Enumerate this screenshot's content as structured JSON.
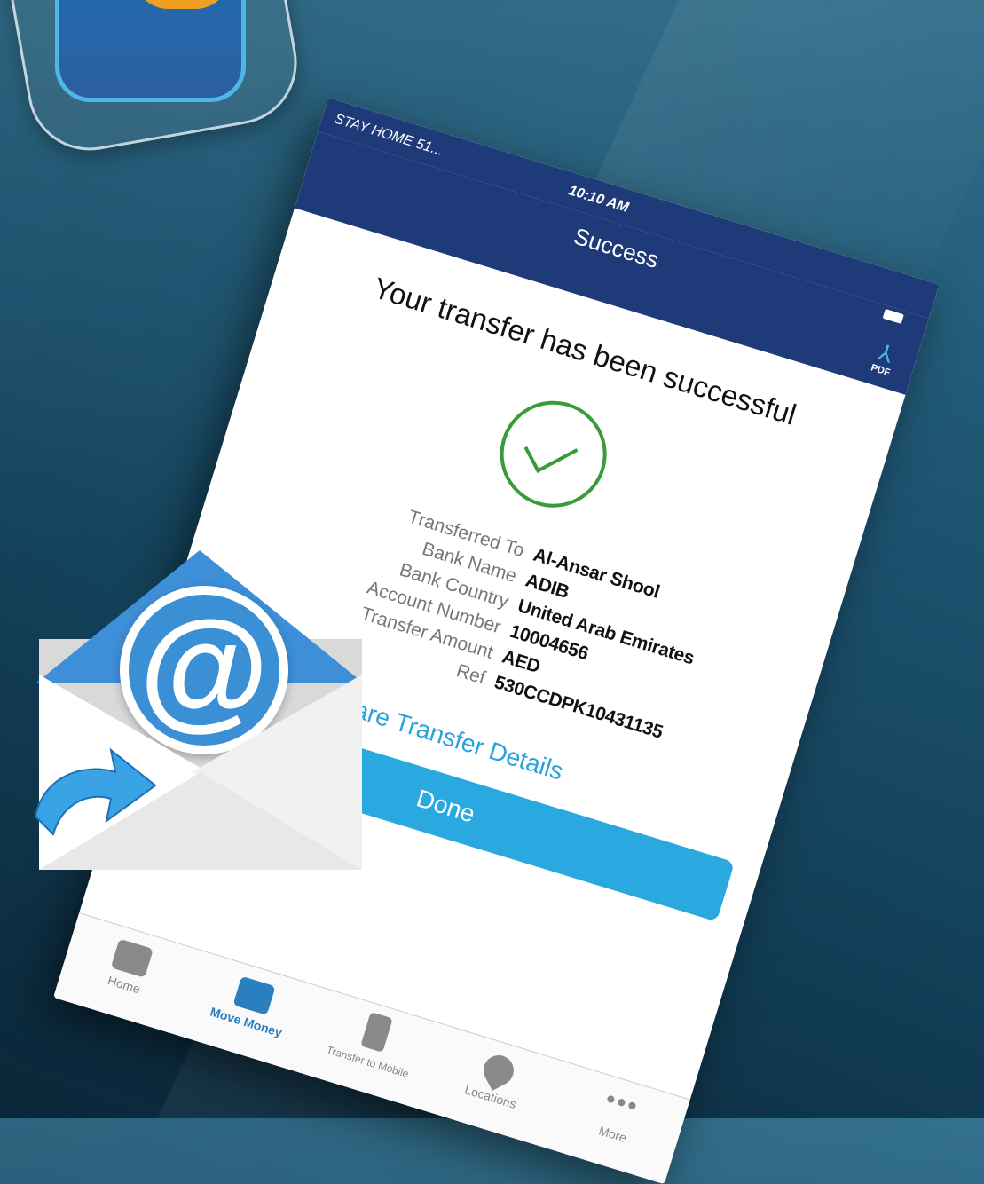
{
  "status": {
    "carrier": "STAY HOME 51...",
    "time": "10:10 AM"
  },
  "header": {
    "title": "Success",
    "pdf_label": "PDF"
  },
  "headline": "Your transfer has been successful",
  "details": [
    {
      "label": "Transferred To",
      "value": "Al-Ansar Shool"
    },
    {
      "label": "Bank Name",
      "value": "ADIB"
    },
    {
      "label": "Bank Country",
      "value": "United Arab Emirates"
    },
    {
      "label": "Account Number",
      "value": "10004656"
    },
    {
      "label": "Transfer Amount",
      "value": "AED"
    },
    {
      "label": "Ref",
      "value": "530CCDPK10431135"
    }
  ],
  "share_label": "Share Transfer Details",
  "done_label": "Done",
  "tabs": [
    {
      "label": "Home",
      "icon": "wallet-icon"
    },
    {
      "label": "Move Money",
      "icon": "money-transfer-icon",
      "active": true
    },
    {
      "label": "Transfer to Mobile",
      "icon": "mobile-transfer-icon"
    },
    {
      "label": "Locations",
      "icon": "location-pin-icon"
    },
    {
      "label": "More",
      "icon": "more-dots-icon"
    }
  ],
  "colors": {
    "header_bg": "#1e3a78",
    "accent": "#2aa8e0",
    "success_green": "#3a9b3a"
  }
}
